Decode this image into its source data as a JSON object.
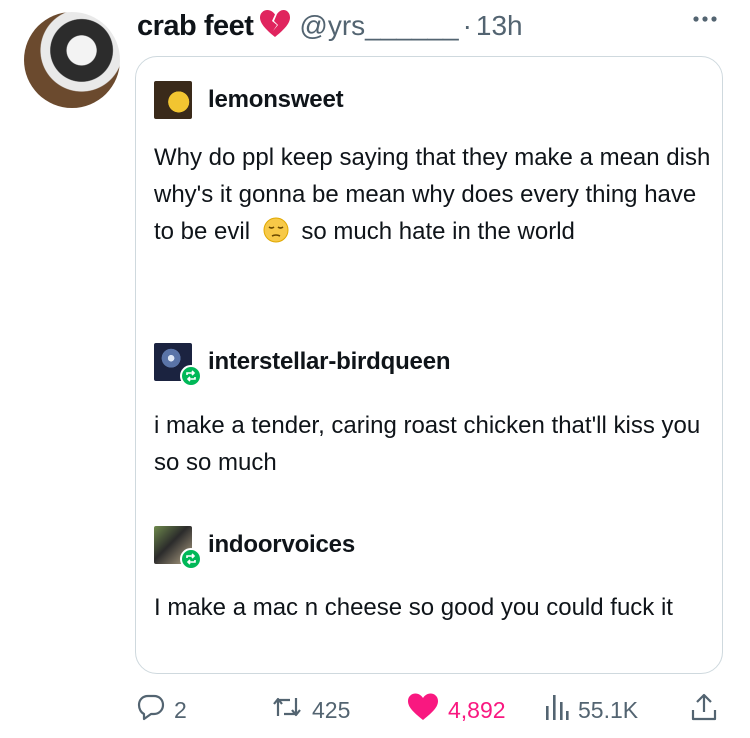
{
  "tweet": {
    "display_name": "crab feet",
    "name_emoji": "broken-heart-icon",
    "handle": "@yrs______",
    "separator": "·",
    "time": "13h"
  },
  "card": {
    "posts": [
      {
        "username": "lemonsweet",
        "text_before": "Why do ppl keep saying that they make a mean dish why's it gonna be mean why does every thing have to be evil",
        "emoji": "pensive-face-icon",
        "text_after": "so much hate in the world"
      },
      {
        "username": "interstellar-birdqueen",
        "text": "i make a tender, caring roast chicken that'll kiss you so so much"
      },
      {
        "username": "indoorvoices",
        "text": "I make a mac n cheese so good you could fuck it"
      }
    ]
  },
  "actions": {
    "replies": "2",
    "reposts": "425",
    "likes": "4,892",
    "views": "55.1K"
  },
  "colors": {
    "like": "#f91880",
    "muted": "#536471",
    "reblog_badge": "#00b858",
    "border": "#cfd9de"
  }
}
